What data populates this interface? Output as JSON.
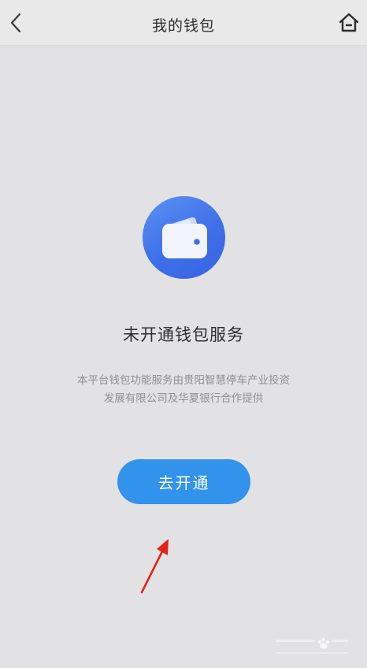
{
  "header": {
    "title": "我的钱包",
    "back_icon": "chevron-left-icon",
    "home_icon": "home-icon"
  },
  "main": {
    "wallet_icon": "wallet-icon",
    "status_title": "未开通钱包服务",
    "description_line1": "本平台钱包功能服务由贵阳智慧停车产业投资",
    "description_line2": "发展有限公司及华夏银行合作提供",
    "open_button_label": "去开通"
  },
  "colors": {
    "background": "#e2e2e4",
    "header_background": "#e9e9ea",
    "button": "#3293ec",
    "wallet_circle": "#4a7cec",
    "annotation_arrow": "#e2231a"
  }
}
